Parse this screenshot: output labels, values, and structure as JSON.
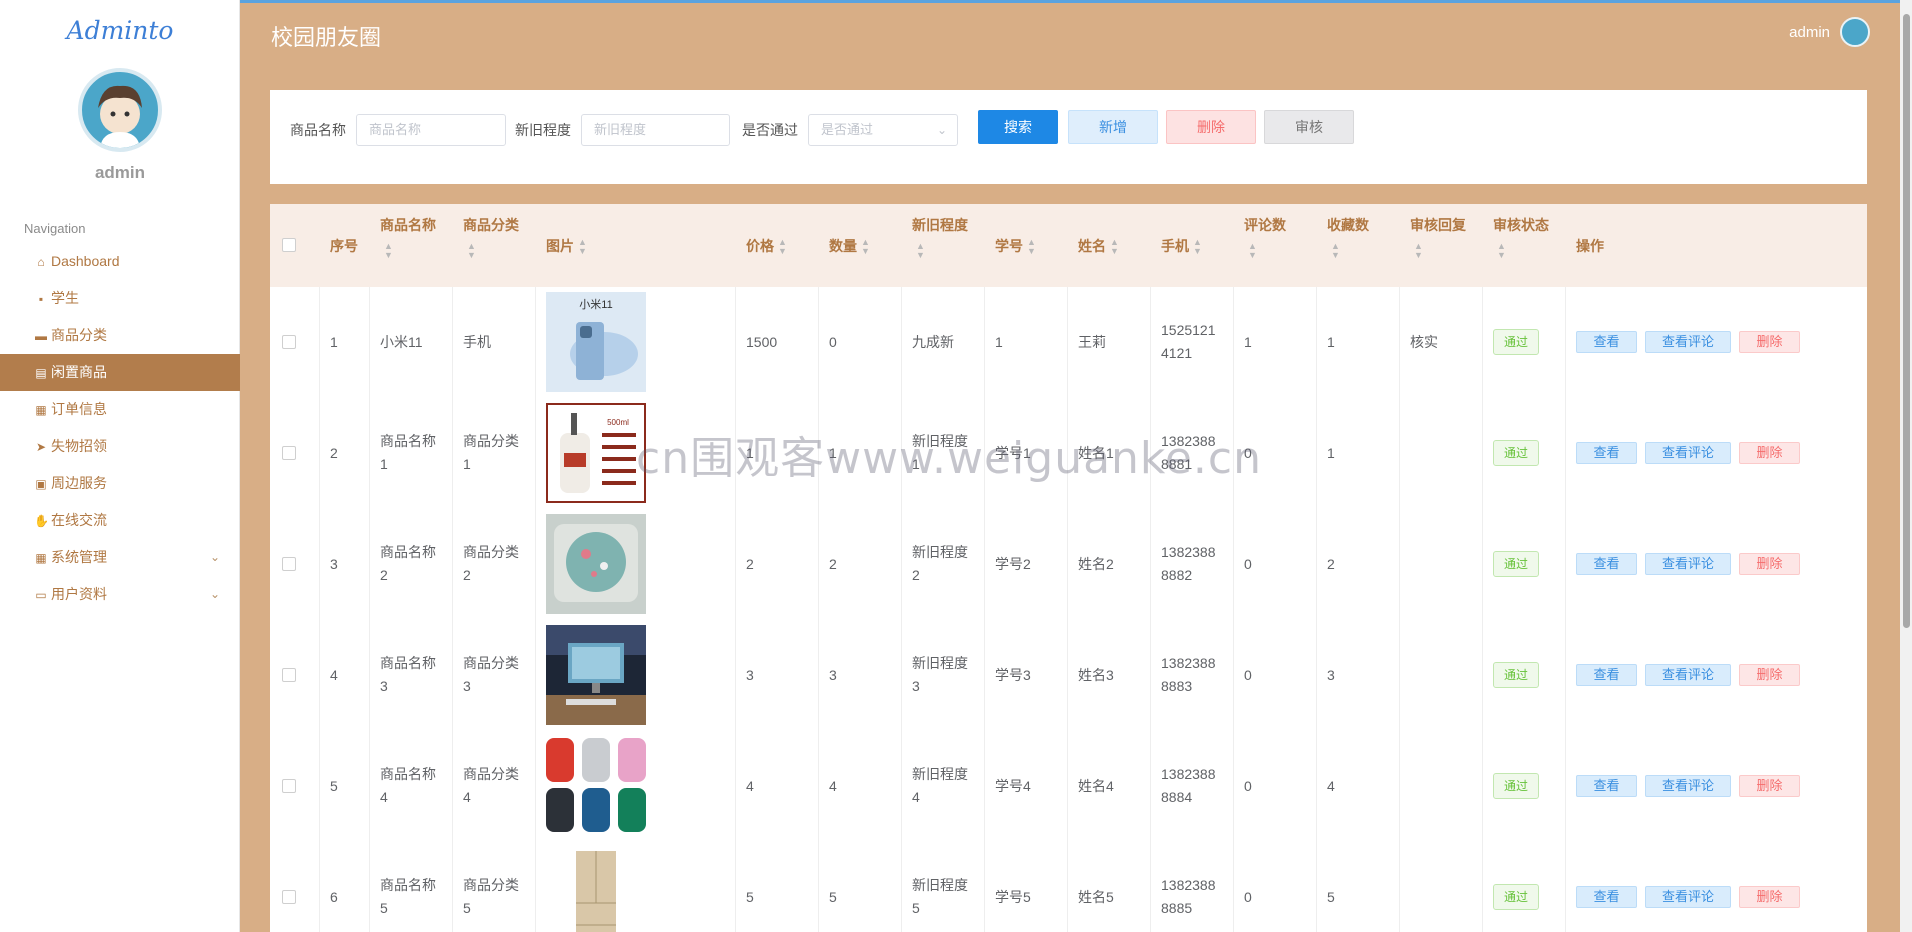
{
  "app": {
    "logo": "Adminto",
    "user": "admin",
    "page_title": "校园朋友圈"
  },
  "sidebar": {
    "heading": "Navigation",
    "items": [
      {
        "label": "Dashboard",
        "icon": "home-icon",
        "glyph": "⌂"
      },
      {
        "label": "学生",
        "icon": "chat-icon",
        "glyph": "▪"
      },
      {
        "label": "商品分类",
        "icon": "briefcase-icon",
        "glyph": "▬"
      },
      {
        "label": "闲置商品",
        "icon": "clipboard-icon",
        "glyph": "▤",
        "active": true
      },
      {
        "label": "订单信息",
        "icon": "grid-icon",
        "glyph": "▦"
      },
      {
        "label": "失物招领",
        "icon": "send-icon",
        "glyph": "➤"
      },
      {
        "label": "周边服务",
        "icon": "checklist-icon",
        "glyph": "▣"
      },
      {
        "label": "在线交流",
        "icon": "thumbs-up-icon",
        "glyph": "✋"
      },
      {
        "label": "系统管理",
        "icon": "grid-icon",
        "glyph": "▦",
        "expandable": true
      },
      {
        "label": "用户资料",
        "icon": "card-icon",
        "glyph": "▭",
        "expandable": true
      }
    ]
  },
  "search": {
    "name_label": "商品名称",
    "name_placeholder": "商品名称",
    "cond_label": "新旧程度",
    "cond_placeholder": "新旧程度",
    "pass_label": "是否通过",
    "pass_placeholder": "是否通过",
    "btn_search": "搜索",
    "btn_add": "新增",
    "btn_delete": "删除",
    "btn_audit": "审核"
  },
  "table": {
    "headers": {
      "index": "序号",
      "name": "商品名称",
      "category": "商品分类",
      "image": "图片",
      "price": "价格",
      "qty": "数量",
      "condition": "新旧程度",
      "student_no": "学号",
      "student_name": "姓名",
      "phone": "手机",
      "comments": "评论数",
      "favorites": "收藏数",
      "reply": "审核回复",
      "status": "审核状态",
      "actions": "操作"
    },
    "action_labels": {
      "view": "查看",
      "comments": "查看评论",
      "delete": "删除"
    },
    "rows": [
      {
        "index": "1",
        "name": [
          "小米11"
        ],
        "category": [
          "手机"
        ],
        "image": "phone",
        "image_text": "小米11",
        "price": "1500",
        "qty": "0",
        "condition": [
          "九成新"
        ],
        "student_no": "1",
        "student_name": "王莉",
        "phone": [
          "1525121",
          "4121"
        ],
        "comments": "1",
        "favorites": "1",
        "reply": "核实",
        "status": "通过"
      },
      {
        "index": "2",
        "name": [
          "商品名称",
          "1"
        ],
        "category": [
          "商品分类",
          "1"
        ],
        "image": "bottle",
        "image_text": "500ml",
        "price": "1",
        "qty": "1",
        "condition": [
          "新旧程度",
          "1"
        ],
        "student_no": "学号1",
        "student_name": "姓名1",
        "phone": [
          "1382388",
          "8881"
        ],
        "comments": "0",
        "favorites": "1",
        "reply": "",
        "status": "通过"
      },
      {
        "index": "3",
        "name": [
          "商品名称",
          "2"
        ],
        "category": [
          "商品分类",
          "2"
        ],
        "image": "pillow",
        "image_text": "",
        "price": "2",
        "qty": "2",
        "condition": [
          "新旧程度",
          "2"
        ],
        "student_no": "学号2",
        "student_name": "姓名2",
        "phone": [
          "1382388",
          "8882"
        ],
        "comments": "0",
        "favorites": "2",
        "reply": "",
        "status": "通过"
      },
      {
        "index": "4",
        "name": [
          "商品名称",
          "3"
        ],
        "category": [
          "商品分类",
          "3"
        ],
        "image": "monitor",
        "image_text": "",
        "price": "3",
        "qty": "3",
        "condition": [
          "新旧程度",
          "3"
        ],
        "student_no": "学号3",
        "student_name": "姓名3",
        "phone": [
          "1382388",
          "8883"
        ],
        "comments": "0",
        "favorites": "3",
        "reply": "",
        "status": "通过"
      },
      {
        "index": "5",
        "name": [
          "商品名称",
          "4"
        ],
        "category": [
          "商品分类",
          "4"
        ],
        "image": "speakers",
        "image_text": "",
        "price": "4",
        "qty": "4",
        "condition": [
          "新旧程度",
          "4"
        ],
        "student_no": "学号4",
        "student_name": "姓名4",
        "phone": [
          "1382388",
          "8884"
        ],
        "comments": "0",
        "favorites": "4",
        "reply": "",
        "status": "通过"
      },
      {
        "index": "6",
        "name": [
          "商品名称",
          "5"
        ],
        "category": [
          "商品分类",
          "5"
        ],
        "image": "fridge",
        "image_text": "",
        "price": "5",
        "qty": "5",
        "condition": [
          "新旧程度",
          "5"
        ],
        "student_no": "学号5",
        "student_name": "姓名5",
        "phone": [
          "1382388",
          "8885"
        ],
        "comments": "0",
        "favorites": "5",
        "reply": "",
        "status": "通过"
      }
    ]
  },
  "watermark": "cn围观客www.weiguanke.cn",
  "colors": {
    "brand": "#d8ae86",
    "active_nav": "#b27d4c",
    "primary": "#1e88e5",
    "danger": "#f56c6c",
    "success": "#67c23a"
  }
}
